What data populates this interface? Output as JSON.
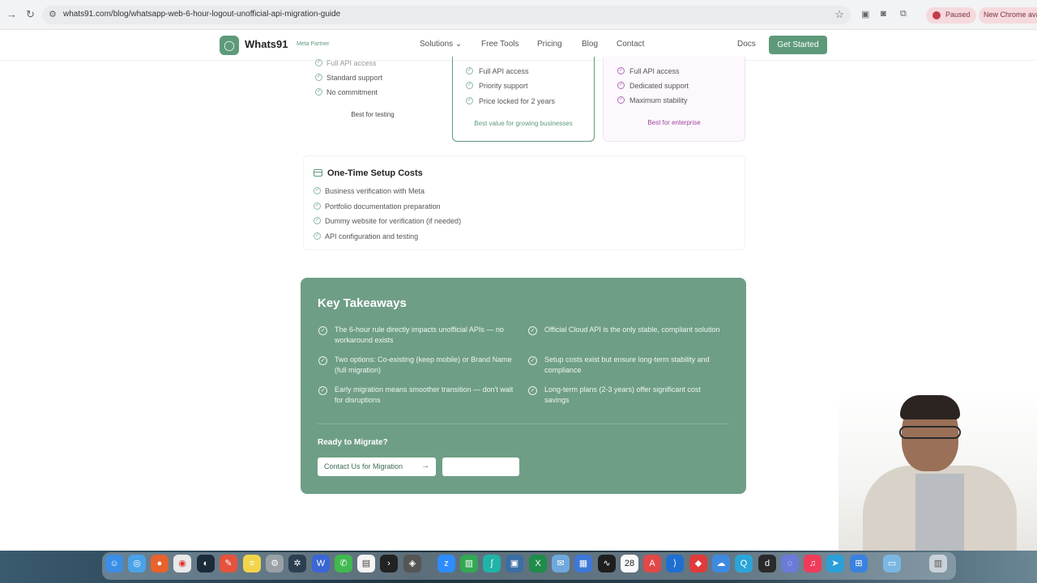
{
  "browser": {
    "url": "whats91.com/blog/whatsapp-web-6-hour-logout-unofficial-api-migration-guide",
    "paused_label": "Paused",
    "new_chrome_label": "New Chrome ava"
  },
  "header": {
    "logo_text": "Whats91",
    "meta_badge": "Meta Partner",
    "nav": [
      "Solutions ⌄",
      "Free Tools",
      "Pricing",
      "Blog",
      "Contact"
    ],
    "docs": "Docs",
    "cta": "Get Started"
  },
  "pricing": {
    "basic": {
      "features": [
        "Full API access",
        "Standard support",
        "No commitment"
      ],
      "note": "Best for testing"
    },
    "pro": {
      "features": [
        "Full API access",
        "Priority support",
        "Price locked for 2 years"
      ],
      "note": "Best value for growing businesses"
    },
    "enterprise": {
      "features": [
        "Full API access",
        "Dedicated support",
        "Maximum stability"
      ],
      "note": "Best for enterprise"
    }
  },
  "setup": {
    "title": "One-Time Setup Costs",
    "items": [
      "Business verification with Meta",
      "Portfolio documentation preparation",
      "Dummy website for verification (if needed)",
      "API configuration and testing"
    ]
  },
  "takeaways": {
    "title": "Key Takeaways",
    "items": [
      "The 6-hour rule directly impacts unofficial APIs — no workaround exists",
      "Official Cloud API is the only stable, compliant solution",
      "Two options: Co-existing (keep mobile) or Brand Name (full migration)",
      "Setup costs exist but ensure long-term stability and compliance",
      "Early migration means smoother transition — don't wait for disruptions",
      "Long-term plans (2-3 years) offer significant cost savings"
    ],
    "ready": "Ready to Migrate?",
    "contact_button": "Contact Us for Migration",
    "secondary_button": ""
  },
  "dock": {
    "calendar_day": "28"
  },
  "colors": {
    "brand_green": "#5e9a7a",
    "takeaway_bg": "#6f9e86",
    "enterprise_purple": "#b06db7"
  }
}
